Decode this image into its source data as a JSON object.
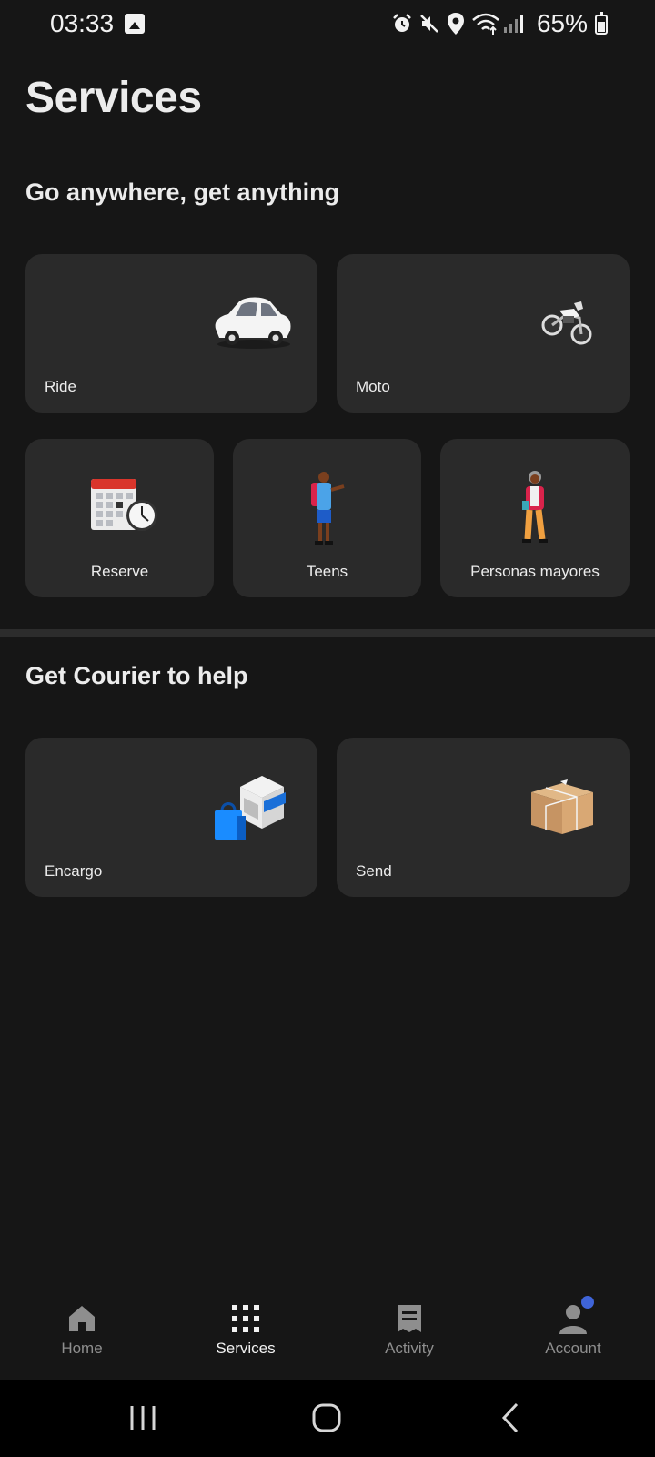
{
  "status_bar": {
    "time": "03:33",
    "battery": "65%",
    "icons": [
      "image-icon",
      "alarm-icon",
      "mute-icon",
      "location-icon",
      "wifi-icon",
      "signal-icon",
      "battery-icon"
    ]
  },
  "page": {
    "title": "Services"
  },
  "sections": {
    "go_anywhere": {
      "title": "Go anywhere, get anything",
      "tiles": {
        "ride": "Ride",
        "moto": "Moto",
        "reserve": "Reserve",
        "teens": "Teens",
        "seniors": "Personas mayores"
      }
    },
    "courier": {
      "title": "Get Courier to help",
      "tiles": {
        "encargo": "Encargo",
        "send": "Send"
      }
    }
  },
  "bottom_nav": {
    "items": [
      {
        "label": "Home",
        "icon": "home-icon",
        "active": false
      },
      {
        "label": "Services",
        "icon": "grid-icon",
        "active": true
      },
      {
        "label": "Activity",
        "icon": "receipt-icon",
        "active": false
      },
      {
        "label": "Account",
        "icon": "person-icon",
        "active": false
      }
    ]
  },
  "colors": {
    "background": "#161616",
    "tile": "#2a2a2a",
    "text": "#ececec",
    "nav_inactive": "#8e8e8e",
    "notification_dot": "#3f64d8"
  }
}
